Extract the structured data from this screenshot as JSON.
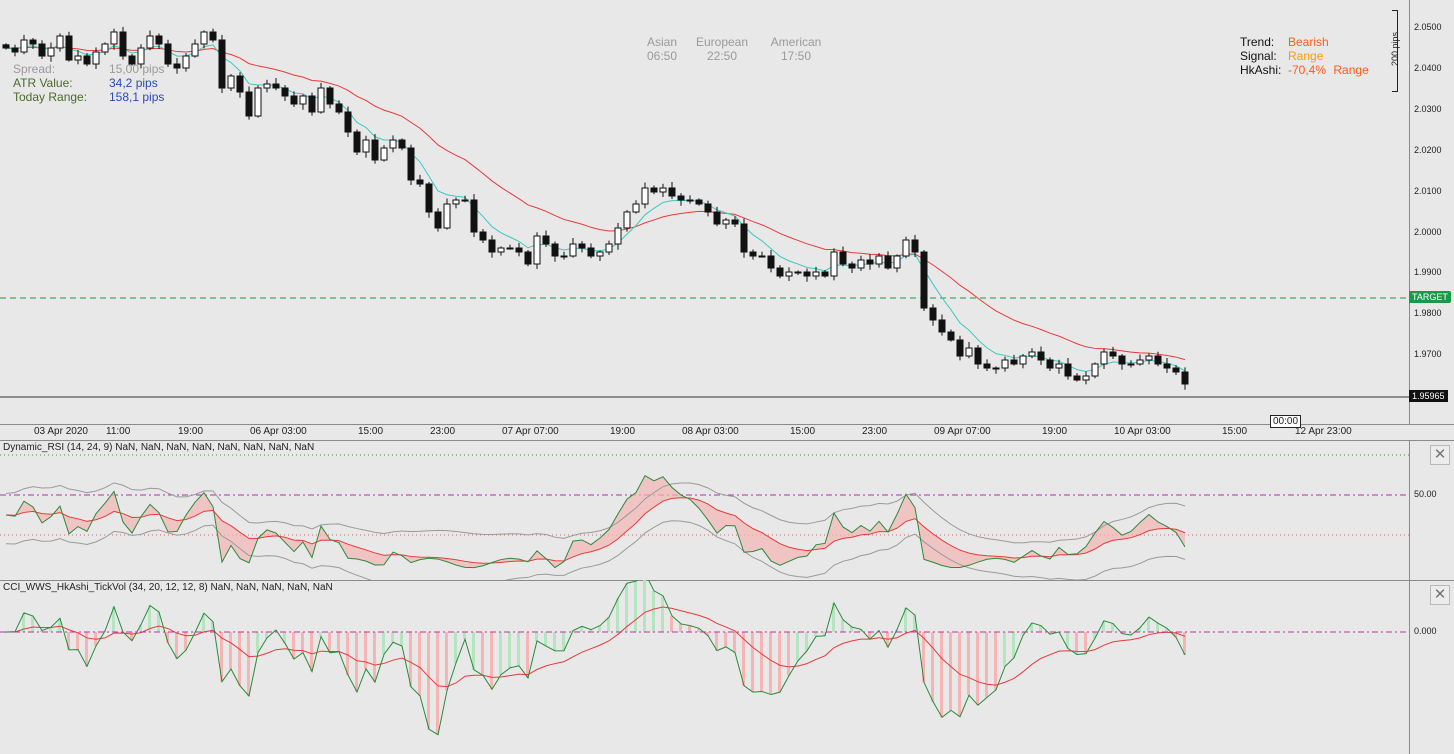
{
  "info_panel": {
    "spread_label": "Spread:",
    "spread_value": "15,00 pips",
    "atr_label": "ATR Value:",
    "atr_value": "34,2 pips",
    "range_label": "Today Range:",
    "range_value": "158,1 pips"
  },
  "sessions": [
    {
      "name": "Asian",
      "time": "06:50"
    },
    {
      "name": "European",
      "time": "22:50"
    },
    {
      "name": "American",
      "time": "17:50"
    }
  ],
  "trend_panel": {
    "trend_label": "Trend:",
    "trend_value": "Bearish",
    "signal_label": "Signal:",
    "signal_value": "Range",
    "hkashi_label": "HkAshi:",
    "hkashi_pct": "-70,4%",
    "hkashi_value": "Range"
  },
  "price_axis": {
    "scale_label": "200 pips",
    "ticks": [
      "2.0500",
      "2.0400",
      "2.0300",
      "2.0200",
      "2.0100",
      "2.0000",
      "1.9900",
      "1.9800",
      "1.9700"
    ],
    "target_label": "TARGET",
    "current_price": "1.95965"
  },
  "time_axis": {
    "ticks": [
      "03 Apr 2020",
      "11:00",
      "19:00",
      "06 Apr 03:00",
      "15:00",
      "23:00",
      "07 Apr 07:00",
      "19:00",
      "08 Apr 03:00",
      "15:00",
      "23:00",
      "09 Apr 07:00",
      "19:00",
      "10 Apr 03:00",
      "15:00",
      "12 Apr 23:00"
    ],
    "cursor_time": "00:00"
  },
  "rsi_panel": {
    "label": "Dynamic_RSI (14, 24, 9) NaN, NaN, NaN, NaN, NaN, NaN, NaN, NaN",
    "level": "50.00",
    "close_glyph": "✕"
  },
  "cci_panel": {
    "label": "CCI_WWS_HkAshi_TickVol (34, 20, 12, 12, 8) NaN, NaN, NaN, NaN, NaN",
    "level": "0.000",
    "close_glyph": "✕"
  },
  "colors": {
    "bg": "#e8e8e8",
    "ema_slow": "#e83a3a",
    "ema_fast": "#3cc8c0",
    "bullish_fill": "#b5e5c0",
    "bearish_fill": "#f5b5b5",
    "target": "#1a9a48",
    "bearish_text": "#ff5a1a",
    "range_text": "#ff9a00",
    "info_green": "#4a6a2a",
    "info_blue": "#2a4ab8"
  },
  "chart_data": {
    "type": "candlestick",
    "symbol_scale_pips": 200,
    "ylim": [
      1.95,
      2.056
    ],
    "current_price": 1.95965,
    "target_price": 1.9835,
    "close": [
      2.044,
      2.043,
      2.046,
      2.045,
      2.042,
      2.044,
      2.047,
      2.041,
      2.042,
      2.04,
      2.043,
      2.045,
      2.048,
      2.042,
      2.04,
      2.044,
      2.047,
      2.045,
      2.04,
      2.039,
      2.042,
      2.045,
      2.048,
      2.046,
      2.034,
      2.037,
      2.033,
      2.027,
      2.034,
      2.035,
      2.034,
      2.032,
      2.03,
      2.032,
      2.028,
      2.034,
      2.03,
      2.028,
      2.023,
      2.018,
      2.021,
      2.016,
      2.019,
      2.021,
      2.019,
      2.011,
      2.01,
      2.003,
      1.999,
      2.005,
      2.006,
      2.006,
      1.998,
      1.996,
      1.993,
      1.994,
      1.994,
      1.993,
      1.99,
      1.997,
      1.995,
      1.992,
      1.992,
      1.995,
      1.994,
      1.992,
      1.993,
      1.995,
      1.999,
      2.003,
      2.005,
      2.009,
      2.008,
      2.009,
      2.007,
      2.006,
      2.006,
      2.005,
      2.003,
      2.0,
      2.001,
      2.0,
      1.993,
      1.992,
      1.992,
      1.989,
      1.987,
      1.988,
      1.988,
      1.987,
      1.988,
      1.987,
      1.993,
      1.99,
      1.989,
      1.991,
      1.99,
      1.992,
      1.989,
      1.992,
      1.996,
      1.993,
      1.979,
      1.976,
      1.973,
      1.971,
      1.967,
      1.969,
      1.965,
      1.964,
      1.964,
      1.966,
      1.965,
      1.967,
      1.968,
      1.966,
      1.964,
      1.965,
      1.962,
      1.961,
      1.962,
      1.965,
      1.968,
      1.967,
      1.965,
      1.965,
      1.966,
      1.967,
      1.965,
      1.964,
      1.963,
      1.96
    ],
    "ema_fast_last": 1.9638,
    "ema_slow_last": 1.968,
    "rsi_level": 50,
    "cci_level": 0
  }
}
